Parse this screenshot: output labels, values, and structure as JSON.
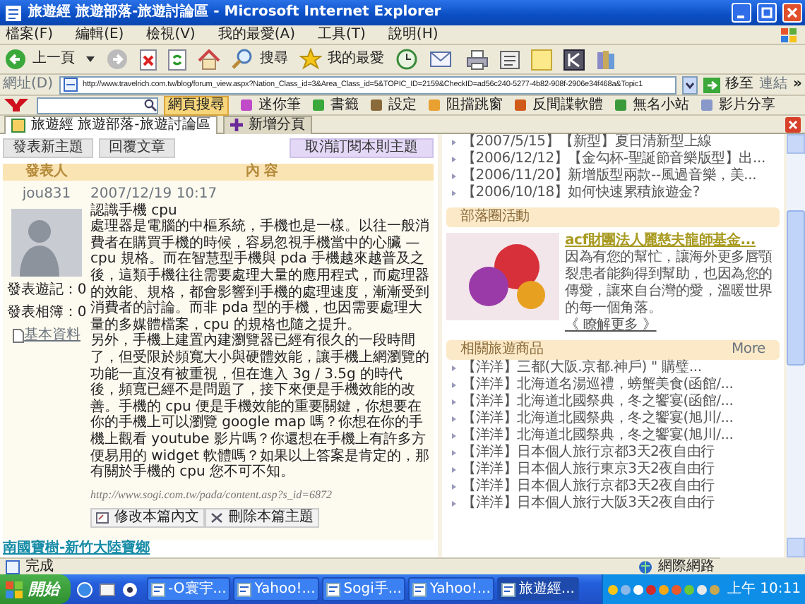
{
  "window": {
    "title": "旅遊經 旅遊部落-旅遊討論區 - Microsoft Internet Explorer"
  },
  "menu": [
    "檔案(F)",
    "編輯(E)",
    "檢視(V)",
    "我的最愛(A)",
    "工具(T)",
    "說明(H)"
  ],
  "toolbar": {
    "back": "上一頁",
    "search": "搜尋",
    "favorites": "我的最愛"
  },
  "address_bar": {
    "label": "網址(D)",
    "url": "http://www.travelrich.com.tw/blog/forum_view.aspx?Nation_Class_id=3&Area_Class_id=5&TOPIC_ID=2159&CheckID=ad56c240-5277-4b82-908f-2906e34f468a&Topic1",
    "go": "移至",
    "links": "連結",
    "more": "»"
  },
  "yahoo_toolbar": {
    "search_button": "網頁搜尋",
    "items": [
      "迷你筆",
      "書籤",
      "設定",
      "阻擋跳窗",
      "反間諜軟體",
      "無名小站",
      "影片分享"
    ]
  },
  "tabs": [
    {
      "label": "旅遊經 旅遊部落-旅遊討論區",
      "selected": true
    }
  ],
  "new_tab": "新增分頁",
  "forum": {
    "actions": [
      "發表新主題",
      "回覆文章"
    ],
    "unsubscribe": "取消訂閱本則主題",
    "columns": [
      "發表人",
      "內 容"
    ],
    "author": {
      "name": "jou831",
      "stats": [
        "發表遊記：0",
        "發表相簿：0"
      ],
      "profile_link": "基本資料"
    },
    "post": {
      "date": "2007/12/19 10:17",
      "title": "認識手機 cpu",
      "paragraphs": [
        "處理器是電腦的中樞系統，手機也是一樣。以往一般消費者在購買手機的時候，容易忽視手機當中的心臟 — cpu 規格。而在智慧型手機與 pda 手機越來越普及之後，這類手機往往需要處理大量的應用程式，而處理器的效能、規格，都會影響到手機的處理速度，漸漸受到消費者的討論。而非 pda 型的手機，也因需要處理大量的多媒體檔案，cpu 的規格也隨之提升。",
        "另外，手機上建置內建瀏覽器已經有很久的一段時間了，但受限於頻寬大小與硬體效能，讓手機上網瀏覽的功能一直沒有被重視，但在進入 3g / 3.5g 的時代後，頻寬已經不是問題了，接下來便是手機效能的改善。手機的 cpu 便是手機效能的重要關鍵，你想要在你的手機上可以瀏覽 google map 嗎？你想在你的手機上觀看 youtube 影片嗎？你還想在手機上有許多方便易用的 widget 軟體嗎？如果以上答案是肯定的，那有關於手機的 cpu 您不可不知。"
      ],
      "source_url": "http://www.sogi.com.tw/pada/content.asp?s_id=6872",
      "buttons": [
        "修改本篇內文",
        "刪除本篇主題"
      ]
    },
    "footer_link": "南國寶樹-新竹大陸寶鄉"
  },
  "sidebar": {
    "news": [
      "【2007/5/15】【新型】夏日清新型上線",
      "【2006/12/12】【金勾杯-聖誕節音樂版型】出...",
      "【2006/11/20】新增版型兩款--風過音樂，美...",
      "【2006/10/18】如何快速累積旅遊金?"
    ],
    "activity": {
      "heading": "部落圈活動",
      "title": "acf財團法人麗慈夫龍師基金...",
      "description": "因為有您的幫忙，讓海外更多唇顎裂患者能夠得到幫助，也因為您的傳愛，讓來自台灣的愛，溫暖世界的每一個角落。",
      "more": "《 瞭解更多 》"
    },
    "products": {
      "heading": "相關旅遊商品",
      "more": "More",
      "items": [
        "【洋洋】三都(大阪.京都.神戶) \" 購璧...",
        "【洋洋】北海道名湯巡禮，螃蟹美食(函館/...",
        "【洋洋】北海道北國祭典，冬之饗宴(函館/...",
        "【洋洋】北海道北國祭典，冬之饗宴(旭川/...",
        "【洋洋】北海道北國祭典，冬之饗宴(旭川/...",
        "【洋洋】日本個人旅行京都3天2夜自由行",
        "【洋洋】日本個人旅行東京3天2夜自由行",
        "【洋洋】日本個人旅行京都3天2夜自由行",
        "【洋洋】日本個人旅行大阪3天2夜自由行"
      ]
    }
  },
  "status_bar": {
    "text": "完成",
    "zone": "網際網路"
  },
  "taskbar": {
    "start": "開始",
    "tasks": [
      {
        "label": "-O寰宇...",
        "selected": false
      },
      {
        "label": "Yahoo!...",
        "selected": false
      },
      {
        "label": "Sogi手...",
        "selected": false
      },
      {
        "label": "Yahoo!...",
        "selected": false
      },
      {
        "label": "旅遊經...",
        "selected": true
      }
    ],
    "clock": "上午 10:11"
  }
}
